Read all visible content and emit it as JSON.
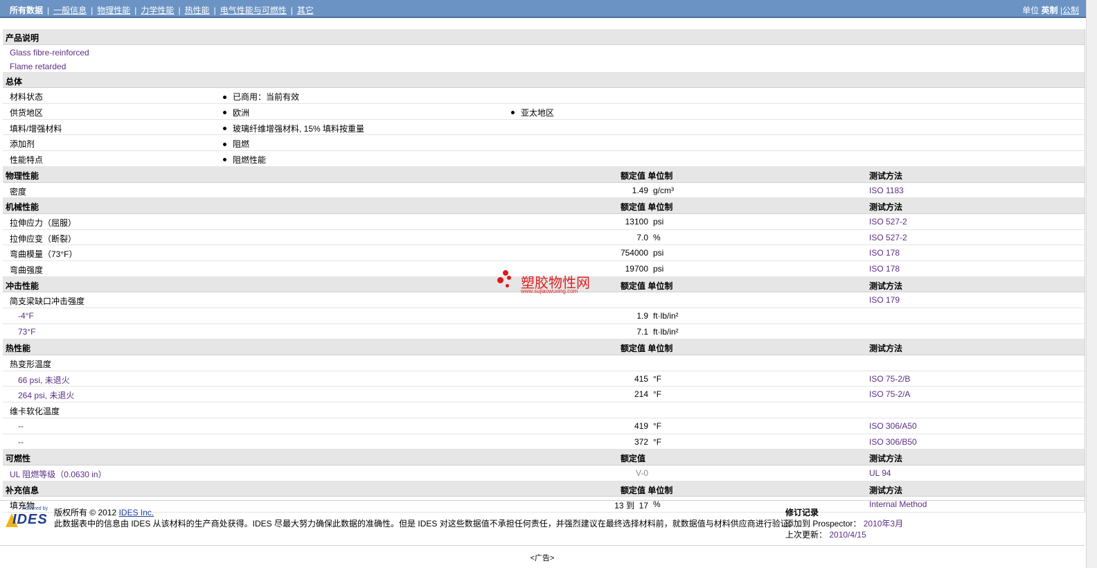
{
  "nav": {
    "tabs": [
      "所有数据",
      "一般信息",
      "物理性能",
      "力学性能",
      "热性能",
      "电气性能与可燃性",
      "其它"
    ],
    "units_label": "单位",
    "units_active": "英制",
    "units_other": "公制"
  },
  "product": {
    "header": "产品说明",
    "lines": [
      "Glass fibre-reinforced",
      "Flame retarded"
    ]
  },
  "general": {
    "header": "总体",
    "rows": [
      {
        "name": "材料状态",
        "v1": "已商用：当前有效",
        "v2": ""
      },
      {
        "name": "供货地区",
        "v1": "欧洲",
        "v2": "亚太地区"
      },
      {
        "name": "填料/增强材料",
        "v1": "玻璃纤维增强材料, 15% 填料按重量",
        "v2": ""
      },
      {
        "name": "添加剂",
        "v1": "阻燃",
        "v2": ""
      },
      {
        "name": "性能特点",
        "v1": "阻燃性能",
        "v2": ""
      }
    ]
  },
  "col_headers": {
    "value": "额定值",
    "unit": "单位制",
    "method": "测试方法",
    "value_unit": "额定值  单位制"
  },
  "physical": {
    "header": "物理性能",
    "rows": [
      {
        "name": "密度",
        "value": "1.49",
        "unit": "g/cm³",
        "method": "ISO 1183"
      }
    ]
  },
  "mechanical": {
    "header": "机械性能",
    "rows": [
      {
        "name": "拉伸应力（屈服）",
        "value": "13100",
        "unit": "psi",
        "method": "ISO 527-2"
      },
      {
        "name": "拉伸应变（断裂）",
        "value": "7.0",
        "unit": "%",
        "method": "ISO 527-2"
      },
      {
        "name": "弯曲模量（73°F）",
        "value": "754000",
        "unit": "psi",
        "method": "ISO 178"
      },
      {
        "name": "弯曲强度",
        "value": "19700",
        "unit": "psi",
        "method": "ISO 178"
      }
    ]
  },
  "impact": {
    "header": "冲击性能",
    "group": {
      "name": "简支梁缺口冲击强度",
      "method": "ISO 179"
    },
    "rows": [
      {
        "name": "-4°F",
        "value": "1.9",
        "unit": "ft·lb/in²"
      },
      {
        "name": "73°F",
        "value": "7.1",
        "unit": "ft·lb/in²"
      }
    ]
  },
  "thermal": {
    "header": "热性能",
    "group1": "热变形温度",
    "rows1": [
      {
        "name": "66 psi, 未退火",
        "value": "415",
        "unit": "°F",
        "method": "ISO 75-2/B"
      },
      {
        "name": "264 psi, 未退火",
        "value": "214",
        "unit": "°F",
        "method": "ISO 75-2/A"
      }
    ],
    "group2": "维卡软化温度",
    "rows2": [
      {
        "name": "--",
        "value": "419",
        "unit": "°F",
        "method": "ISO 306/A50"
      },
      {
        "name": "--",
        "value": "372",
        "unit": "°F",
        "method": "ISO 306/B50"
      }
    ]
  },
  "flammability": {
    "header": "可燃性",
    "rows": [
      {
        "name": "UL 阻燃等级（0.0630 in）",
        "value": "V-0",
        "method": "UL 94"
      }
    ]
  },
  "supplement": {
    "header": "补充信息",
    "rows": [
      {
        "name": "填充物",
        "value_from": "13",
        "to": "到",
        "value_to": "17",
        "unit": "%",
        "method": "Internal Method"
      }
    ]
  },
  "watermark": {
    "zh": "塑胶物性网",
    "en": "www.sujiaowuxing.com"
  },
  "footer": {
    "logo_top": "Powered by",
    "logo_text": "IDES",
    "copyright": "版权所有 © 2012",
    "copyright_link": "IDES Inc.",
    "note": "此数据表中的信息由 IDES 从该材料的生产商处获得。IDES 尽最大努力确保此数据的准确性。但是 IDES 对这些数据值不承担任何责任，并强烈建议在最终选择材料前，就数据值与材料供应商进行验证。",
    "rev_title": "修订记录",
    "added_label": "添加到 Prospector：",
    "added_value": "2010年3月",
    "updated_label": "上次更新：",
    "updated_value": "2010/4/15"
  },
  "ad": "<广告>"
}
